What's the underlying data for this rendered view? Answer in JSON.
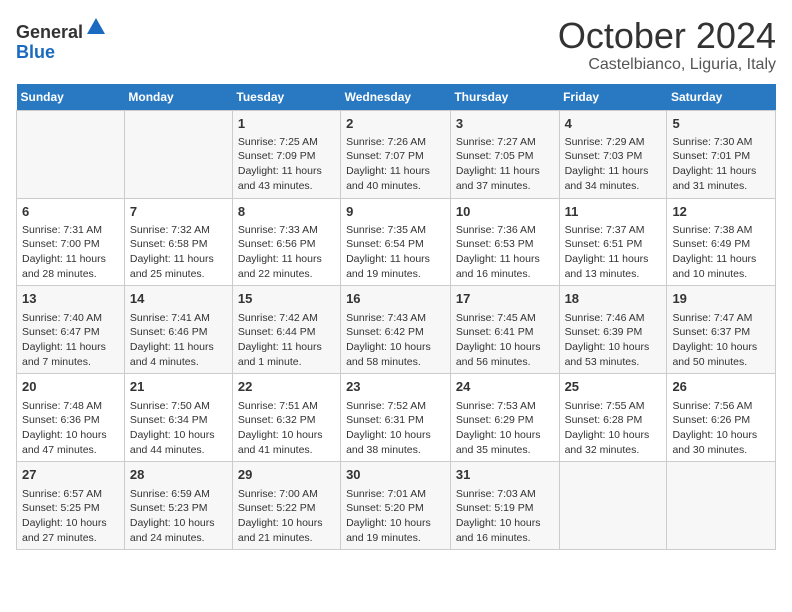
{
  "header": {
    "logo_line1": "General",
    "logo_line2": "Blue",
    "month_title": "October 2024",
    "location": "Castelbianco, Liguria, Italy"
  },
  "days_of_week": [
    "Sunday",
    "Monday",
    "Tuesday",
    "Wednesday",
    "Thursday",
    "Friday",
    "Saturday"
  ],
  "weeks": [
    [
      {
        "day": "",
        "info": ""
      },
      {
        "day": "",
        "info": ""
      },
      {
        "day": "1",
        "info": "Sunrise: 7:25 AM\nSunset: 7:09 PM\nDaylight: 11 hours and 43 minutes."
      },
      {
        "day": "2",
        "info": "Sunrise: 7:26 AM\nSunset: 7:07 PM\nDaylight: 11 hours and 40 minutes."
      },
      {
        "day": "3",
        "info": "Sunrise: 7:27 AM\nSunset: 7:05 PM\nDaylight: 11 hours and 37 minutes."
      },
      {
        "day": "4",
        "info": "Sunrise: 7:29 AM\nSunset: 7:03 PM\nDaylight: 11 hours and 34 minutes."
      },
      {
        "day": "5",
        "info": "Sunrise: 7:30 AM\nSunset: 7:01 PM\nDaylight: 11 hours and 31 minutes."
      }
    ],
    [
      {
        "day": "6",
        "info": "Sunrise: 7:31 AM\nSunset: 7:00 PM\nDaylight: 11 hours and 28 minutes."
      },
      {
        "day": "7",
        "info": "Sunrise: 7:32 AM\nSunset: 6:58 PM\nDaylight: 11 hours and 25 minutes."
      },
      {
        "day": "8",
        "info": "Sunrise: 7:33 AM\nSunset: 6:56 PM\nDaylight: 11 hours and 22 minutes."
      },
      {
        "day": "9",
        "info": "Sunrise: 7:35 AM\nSunset: 6:54 PM\nDaylight: 11 hours and 19 minutes."
      },
      {
        "day": "10",
        "info": "Sunrise: 7:36 AM\nSunset: 6:53 PM\nDaylight: 11 hours and 16 minutes."
      },
      {
        "day": "11",
        "info": "Sunrise: 7:37 AM\nSunset: 6:51 PM\nDaylight: 11 hours and 13 minutes."
      },
      {
        "day": "12",
        "info": "Sunrise: 7:38 AM\nSunset: 6:49 PM\nDaylight: 11 hours and 10 minutes."
      }
    ],
    [
      {
        "day": "13",
        "info": "Sunrise: 7:40 AM\nSunset: 6:47 PM\nDaylight: 11 hours and 7 minutes."
      },
      {
        "day": "14",
        "info": "Sunrise: 7:41 AM\nSunset: 6:46 PM\nDaylight: 11 hours and 4 minutes."
      },
      {
        "day": "15",
        "info": "Sunrise: 7:42 AM\nSunset: 6:44 PM\nDaylight: 11 hours and 1 minute."
      },
      {
        "day": "16",
        "info": "Sunrise: 7:43 AM\nSunset: 6:42 PM\nDaylight: 10 hours and 58 minutes."
      },
      {
        "day": "17",
        "info": "Sunrise: 7:45 AM\nSunset: 6:41 PM\nDaylight: 10 hours and 56 minutes."
      },
      {
        "day": "18",
        "info": "Sunrise: 7:46 AM\nSunset: 6:39 PM\nDaylight: 10 hours and 53 minutes."
      },
      {
        "day": "19",
        "info": "Sunrise: 7:47 AM\nSunset: 6:37 PM\nDaylight: 10 hours and 50 minutes."
      }
    ],
    [
      {
        "day": "20",
        "info": "Sunrise: 7:48 AM\nSunset: 6:36 PM\nDaylight: 10 hours and 47 minutes."
      },
      {
        "day": "21",
        "info": "Sunrise: 7:50 AM\nSunset: 6:34 PM\nDaylight: 10 hours and 44 minutes."
      },
      {
        "day": "22",
        "info": "Sunrise: 7:51 AM\nSunset: 6:32 PM\nDaylight: 10 hours and 41 minutes."
      },
      {
        "day": "23",
        "info": "Sunrise: 7:52 AM\nSunset: 6:31 PM\nDaylight: 10 hours and 38 minutes."
      },
      {
        "day": "24",
        "info": "Sunrise: 7:53 AM\nSunset: 6:29 PM\nDaylight: 10 hours and 35 minutes."
      },
      {
        "day": "25",
        "info": "Sunrise: 7:55 AM\nSunset: 6:28 PM\nDaylight: 10 hours and 32 minutes."
      },
      {
        "day": "26",
        "info": "Sunrise: 7:56 AM\nSunset: 6:26 PM\nDaylight: 10 hours and 30 minutes."
      }
    ],
    [
      {
        "day": "27",
        "info": "Sunrise: 6:57 AM\nSunset: 5:25 PM\nDaylight: 10 hours and 27 minutes."
      },
      {
        "day": "28",
        "info": "Sunrise: 6:59 AM\nSunset: 5:23 PM\nDaylight: 10 hours and 24 minutes."
      },
      {
        "day": "29",
        "info": "Sunrise: 7:00 AM\nSunset: 5:22 PM\nDaylight: 10 hours and 21 minutes."
      },
      {
        "day": "30",
        "info": "Sunrise: 7:01 AM\nSunset: 5:20 PM\nDaylight: 10 hours and 19 minutes."
      },
      {
        "day": "31",
        "info": "Sunrise: 7:03 AM\nSunset: 5:19 PM\nDaylight: 10 hours and 16 minutes."
      },
      {
        "day": "",
        "info": ""
      },
      {
        "day": "",
        "info": ""
      }
    ]
  ]
}
